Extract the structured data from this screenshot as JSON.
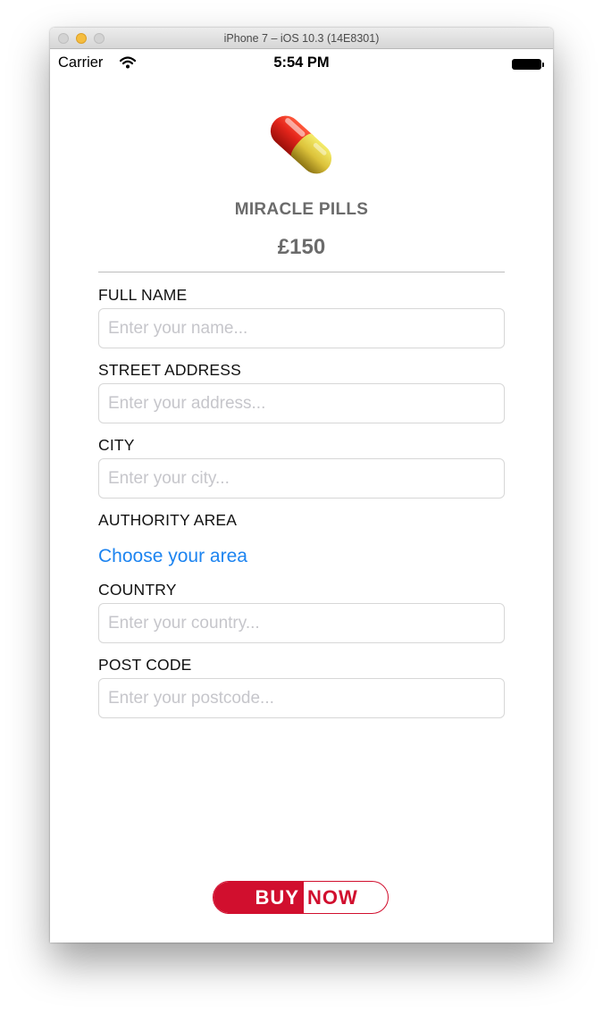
{
  "window": {
    "title": "iPhone 7 – iOS 10.3 (14E8301)"
  },
  "status_bar": {
    "carrier": "Carrier",
    "time": "5:54 PM"
  },
  "product": {
    "name": "MIRACLE PILLS",
    "price": "£150",
    "image_icon": "pill-icon"
  },
  "form": {
    "full_name": {
      "label": "FULL NAME",
      "placeholder": "Enter your name...",
      "value": ""
    },
    "street_address": {
      "label": "STREET ADDRESS",
      "placeholder": "Enter your address...",
      "value": ""
    },
    "city": {
      "label": "CITY",
      "placeholder": "Enter your city...",
      "value": ""
    },
    "authority_area": {
      "label": "AUTHORITY AREA",
      "link_text": "Choose your area"
    },
    "country": {
      "label": "COUNTRY",
      "placeholder": "Enter your country...",
      "value": ""
    },
    "post_code": {
      "label": "POST CODE",
      "placeholder": "Enter your postcode...",
      "value": ""
    }
  },
  "buy_button": {
    "left_text": "BUY",
    "right_text": "NOW"
  },
  "colors": {
    "accent_red": "#d10f2e",
    "link_blue": "#1d84f0",
    "muted_text": "#6b6b6b"
  }
}
